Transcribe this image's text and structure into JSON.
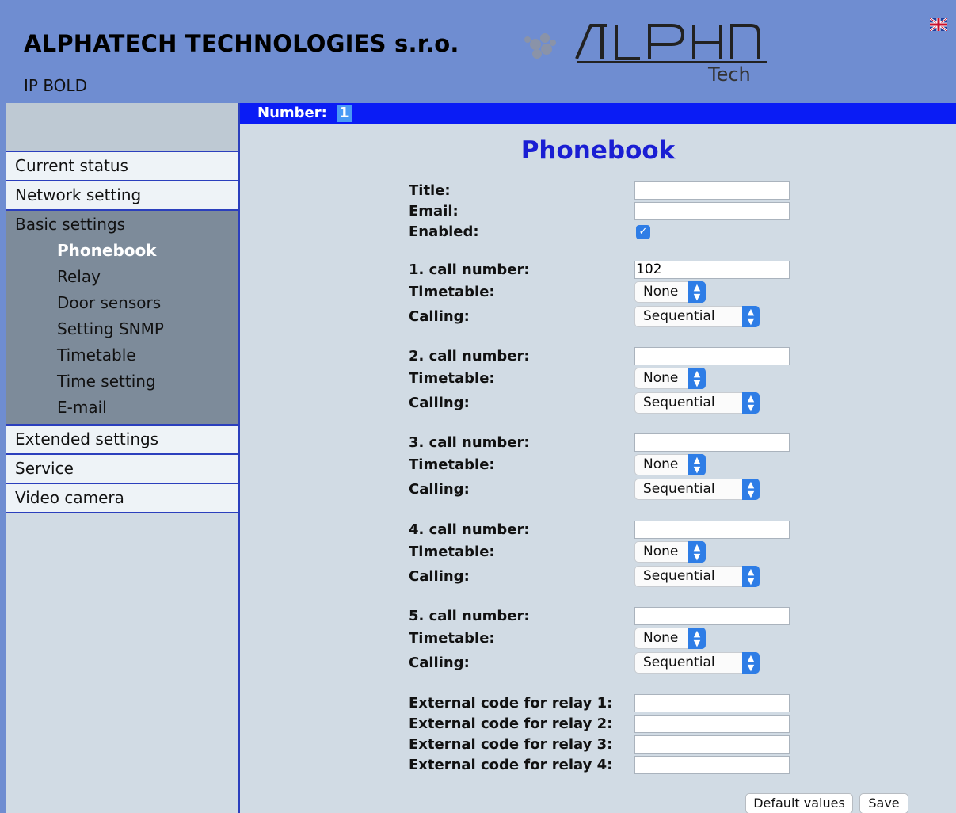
{
  "header": {
    "company": "ALPHATECH TECHNOLOGIES s.r.o.",
    "product": "IP BOLD",
    "logo_text": "ALPHA",
    "logo_subtext": "Tech",
    "flag_icon": "uk-flag-icon"
  },
  "sidebar": {
    "items_top": [
      "Current status",
      "Network setting"
    ],
    "group": {
      "label": "Basic settings",
      "items": [
        "Phonebook",
        "Relay",
        "Door sensors",
        "Setting SNMP",
        "Timetable",
        "Time setting",
        "E-mail"
      ],
      "active": "Phonebook"
    },
    "items_bottom": [
      "Extended settings",
      "Service",
      "Video camera"
    ]
  },
  "numberbar": {
    "label": "Number:",
    "value": "1"
  },
  "page": {
    "title": "Phonebook",
    "fields": {
      "title_label": "Title:",
      "title_value": "",
      "email_label": "Email:",
      "email_value": "",
      "enabled_label": "Enabled:",
      "enabled": true
    },
    "calls": [
      {
        "number_label": "1. call number:",
        "number_value": "102",
        "timetable_label": "Timetable:",
        "timetable_value": "None",
        "calling_label": "Calling:",
        "calling_value": "Sequential"
      },
      {
        "number_label": "2. call number:",
        "number_value": "",
        "timetable_label": "Timetable:",
        "timetable_value": "None",
        "calling_label": "Calling:",
        "calling_value": "Sequential"
      },
      {
        "number_label": "3. call number:",
        "number_value": "",
        "timetable_label": "Timetable:",
        "timetable_value": "None",
        "calling_label": "Calling:",
        "calling_value": "Sequential"
      },
      {
        "number_label": "4. call number:",
        "number_value": "",
        "timetable_label": "Timetable:",
        "timetable_value": "None",
        "calling_label": "Calling:",
        "calling_value": "Sequential"
      },
      {
        "number_label": "5. call number:",
        "number_value": "",
        "timetable_label": "Timetable:",
        "timetable_value": "None",
        "calling_label": "Calling:",
        "calling_value": "Sequential"
      }
    ],
    "relay_codes": [
      {
        "label": "External code for relay 1:",
        "value": ""
      },
      {
        "label": "External code for relay 2:",
        "value": ""
      },
      {
        "label": "External code for relay 3:",
        "value": ""
      },
      {
        "label": "External code for relay 4:",
        "value": ""
      }
    ],
    "buttons": {
      "default": "Default values",
      "save": "Save"
    }
  },
  "colors": {
    "header_bg": "#6f8dd1",
    "number_bar": "#0a1cf5",
    "title": "#1a1ed3",
    "accent": "#2e7de6"
  }
}
